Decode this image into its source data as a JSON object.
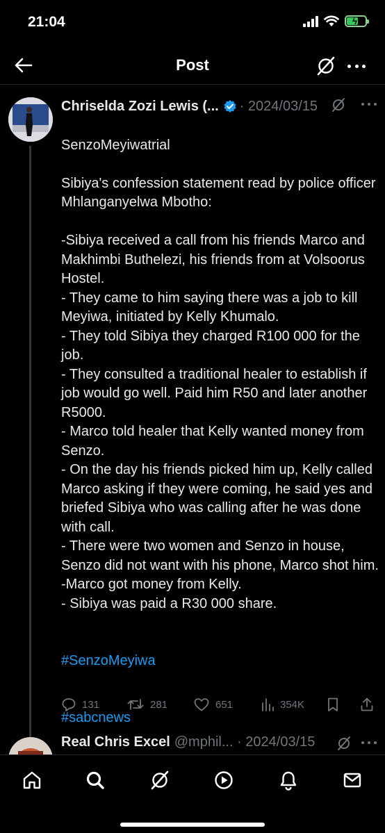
{
  "status_bar": {
    "time": "21:04"
  },
  "header": {
    "title": "Post"
  },
  "post": {
    "author": "Chriselda Zozi Lewis (...",
    "date": "· 2024/03/15",
    "verified_color": "#1d9bf0",
    "body": "SenzoMeyiwatrial\n\nSibiya's confession statement read by police officer Mhlanganyelwa Mbotho:\n\n-Sibiya received a call from his friends Marco and Makhimbi Buthelezi, his friends from at Volsoorus Hostel.\n- They came to him saying there was a job to kill Meyiwa, initiated by Kelly Khumalo.\n- They told Sibiya they charged R100 000 for the job.\n- They consulted a traditional healer to establish if job would go well. Paid him R50 and later another R5000.\n- Marco told healer that Kelly wanted money from Senzo.\n- On the day his friends picked him up, Kelly called Marco asking if they were coming, he said yes and briefed Sibiya who was calling after he was done with call.\n- There were two women and Senzo in house, Senzo did not want with his phone, Marco shot him.\n-Marco got money from Kelly.\n- Sibiya was paid a R30 000 share.",
    "hashtags": [
      "#SenzoMeyiwa",
      "#sabcnews"
    ],
    "stats": {
      "replies": "131",
      "reposts": "281",
      "likes": "651",
      "views": "354K"
    }
  },
  "reply": {
    "author": "Real Chris Excel",
    "handle": "@mphil... · 2024/03/15"
  },
  "bottom_nav": [
    "home-icon",
    "search-icon",
    "grok-icon",
    "video-icon",
    "notifications-icon",
    "messages-icon"
  ]
}
